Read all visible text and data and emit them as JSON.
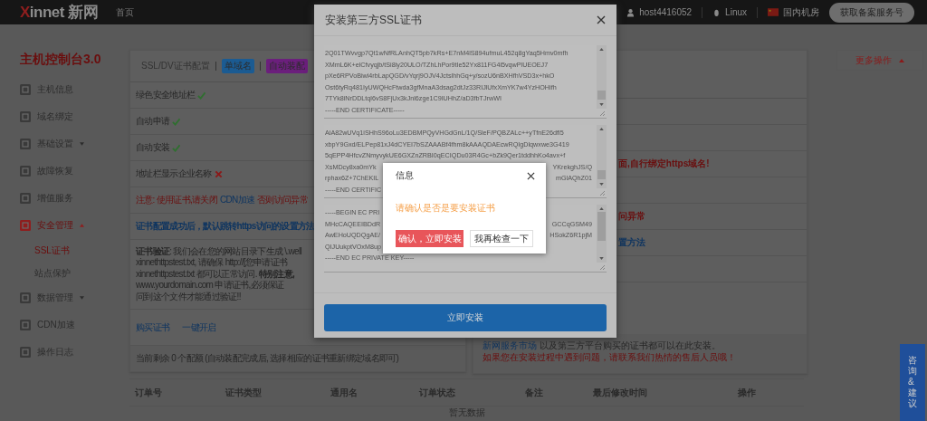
{
  "header": {
    "logo": "Xinnet 新网",
    "home": "首页",
    "user": "host4416052",
    "os": "Linux",
    "region": "国内机房",
    "cta": "获取备案服务号"
  },
  "sidebar": {
    "title": "主机控制台3.0",
    "items": [
      {
        "label": "主机信息",
        "kind": "link",
        "selected": false
      },
      {
        "label": "域名绑定",
        "kind": "link",
        "selected": false
      },
      {
        "label": "基础设置",
        "kind": "group",
        "selected": false,
        "expanded": false
      },
      {
        "label": "故障恢复",
        "kind": "link",
        "selected": false
      },
      {
        "label": "增值服务",
        "kind": "link",
        "selected": false
      },
      {
        "label": "安全管理",
        "kind": "group",
        "selected": true,
        "expanded": true,
        "children": [
          {
            "label": "SSL证书",
            "selected": true
          },
          {
            "label": "站点保护",
            "selected": false
          }
        ]
      },
      {
        "label": "数据管理",
        "kind": "group",
        "selected": false,
        "expanded": false
      },
      {
        "label": "CDN加速",
        "kind": "link",
        "selected": false
      },
      {
        "label": "操作日志",
        "kind": "link",
        "selected": false
      }
    ]
  },
  "left_card": {
    "title": "SSL/DV证书配置",
    "tags": [
      {
        "label": "单域名",
        "color": "#1b5b92"
      },
      {
        "label": "自动装配",
        "color": "#6b1f7c"
      }
    ],
    "rows": [
      {
        "kind": "feature",
        "label": "绿色安全地址栏",
        "ok": true
      },
      {
        "kind": "feature",
        "label": "自动申请",
        "ok": true
      },
      {
        "kind": "feature",
        "label": "自动安装",
        "ok": true
      },
      {
        "kind": "feature",
        "label": "地址栏显示企业名称",
        "ok": false
      },
      {
        "kind": "notice",
        "before": "注意: 使用证书,请关闭",
        "link": "CDN加速",
        "after": "否则访问异常"
      },
      {
        "kind": "guide",
        "text": "证书配置成功后，默认跳转https访问的设置方法"
      },
      {
        "kind": "paragraph",
        "lines": [
          "**证书验证**: 我们会在您的网站目录下生成 \\.well",
          "xinnethttpstest.txt, 请确保 http://[您申请证书",
          "xinnethttpstest.txt 都可以正常访问. **特别注意,**",
          "www.yourdomain.com 申请证书,必须保证",
          "问到这个文件才能通过验证!!"
        ]
      },
      {
        "kind": "actions",
        "links": [
          "购买证书",
          "一键开启"
        ]
      },
      {
        "kind": "footer",
        "text": "当前剩余 0 个配额 (自动装配完成后, 选择相应的证书重新绑定域名即可)"
      }
    ]
  },
  "right_card": {
    "rows": [
      {
        "kind": "blank"
      },
      {
        "kind": "blank"
      },
      {
        "kind": "alert",
        "text": "面,自行绑定https域名!"
      },
      {
        "kind": "blank"
      },
      {
        "kind": "alert",
        "text": "问异常"
      },
      {
        "kind": "guide",
        "text": "置方法"
      },
      {
        "kind": "blank"
      }
    ],
    "footer": {
      "link": "新网服务市场",
      "text": "以及第三方平台购买的证书都可以在此安装。",
      "warning": "如果您在安装过程中遇到问题，请联系我们热情的售后人员哦！"
    }
  },
  "more_actions": {
    "label": "更多操作",
    "expanded": true
  },
  "table": {
    "columns": [
      "订单号",
      "证书类型",
      "通用名",
      "订单状态",
      "备注",
      "最后修改时间",
      "操作"
    ],
    "empty": "暂无数据"
  },
  "feedback_tab": "咨询&建议",
  "modal": {
    "title": "安装第三方SSL证书",
    "fields": [
      {
        "lines": [
          {
            "text": "2Q01TWvvgp7Qt1wNfRLAnhQT5pb7kRs+E7nM4lS894ufmuL452q8gYaq5Hmv0mfh"
          },
          {
            "text": "XMmL6K+elCfvyqjb/tSi8iy20ULO/TZhLhPor9tIe52Yx811FG4i5vqwPlUEOEJ7"
          },
          {
            "text": "pXe6RPVoBiwi4rbLapQGD/vYqrj9OJV4JctslhhGq+y/sozU6nBXHfhVSD3x+hkO"
          },
          {
            "text": "Ost6tyRq481IyUWQHcFtwda3gfMnaA3dsag2dtJz33RIJlUfxXmYK7w4YzHOHifh"
          },
          {
            "text": "7TYk8iNrDDLtql6vS8FjUx3kJnl6zge1C9IUHhZ/aD3fbTJrwWI"
          },
          {
            "text": "-----END CERTIFICATE-----"
          }
        ]
      },
      {
        "lines": [
          {
            "text": "AiA82wUVq1iSHhS96oLu3EDBMPQyVHGdGnL/1Q/SleF/PQBZALc++yTfnE26dfl5"
          },
          {
            "text": "xbpY9Gxd/ELPep81xJ4dCYEI7bSZAAABf4fhm8kAAAQDAEcwRQIgDlqwxwe3G419"
          },
          {
            "text": "5qEPP4HfcvZNmyvykUE6GXZnZRBI0qECIQDu03R4Gc+bZk9Qer1tddhhKo4avx+f"
          },
          {
            "text": "XsMDcy8xa0mYk",
            "tail": "YKrekghJS/Q"
          },
          {
            "text": "rphax6Z+7ChEKIL",
            "tail": "mGlAQhZ01"
          },
          {
            "text": "-----END CERTIFIC"
          }
        ]
      },
      {
        "lines": [
          {
            "text": "-----BEGIN EC PRI"
          },
          {
            "text": "MHcCAQEEIBDdR",
            "tail": "GCCqGSM49"
          },
          {
            "text": "AwEHoUQDQgAE/",
            "tail": "HSokZ6R1pjM"
          },
          {
            "text": "QIJUukptVOxM8up"
          },
          {
            "text": "-----END EC PRIVATE KEY-----"
          }
        ]
      }
    ],
    "submit": "立即安装"
  },
  "dialog": {
    "title": "信息",
    "message": "请确认是否是要安装证书",
    "confirm": "确认，立即安装",
    "cancel": "我再检查一下"
  }
}
